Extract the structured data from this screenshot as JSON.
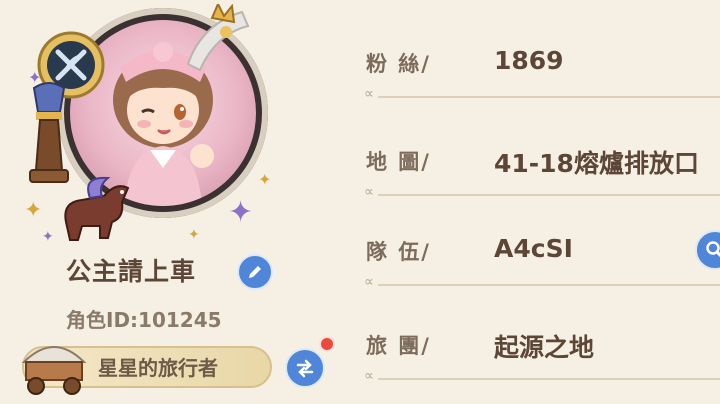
{
  "profile": {
    "player_name": "公主請上車",
    "role_id": "角色ID:101245",
    "title_badge": "星星的旅行者"
  },
  "info_rows": [
    {
      "label": "粉 絲/",
      "value": "1869"
    },
    {
      "label": "地 圖/",
      "value": "41-18熔爐排放口"
    },
    {
      "label": "隊 伍/",
      "value": "A4cSI"
    },
    {
      "label": "旅 團/",
      "value": "起源之地"
    }
  ],
  "colors": {
    "accent_blue": "#4f86d9",
    "notify_red": "#ee4a3c",
    "background": "#f6f0e4"
  },
  "icons": {
    "edit": "pencil-icon",
    "swap": "swap-arrows-icon",
    "search": "magnifier-icon",
    "emblem": "compass-emblem-icon"
  }
}
